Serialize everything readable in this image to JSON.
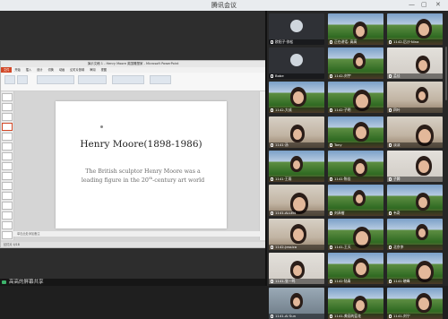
{
  "window": {
    "title": "腾讯会议"
  },
  "ppt": {
    "window_title": "演示文稿 1 - Henry Moore 英国雕塑家 - Microsoft PowerPoint",
    "tabs": [
      "文件",
      "开始",
      "插入",
      "设计",
      "切换",
      "动画",
      "幻灯片放映",
      "审阅",
      "视图"
    ],
    "active_tab": "开始",
    "notes_placeholder": "单击此处添加备注",
    "status": "幻灯片 4/18"
  },
  "slide": {
    "title": "Henry Moore(1898-1986)",
    "body_part1": "The British sculptor Henry Moore was a leading figure in the 20",
    "body_sup": "th",
    "body_part2": "-century art world"
  },
  "share": {
    "status_label": "高高的屏幕共享"
  },
  "participants": [
    {
      "name": "欧阳子·徐松",
      "bg": "dark"
    },
    {
      "name": "正在讲话: 高高",
      "bg": "tree"
    },
    {
      "name": "1142-后沙·Nina",
      "bg": "tree"
    },
    {
      "name": "Bobe",
      "bg": "dark"
    },
    {
      "name": "1142-刘宇",
      "bg": "tree"
    },
    {
      "name": "孟佳",
      "bg": "wall"
    },
    {
      "name": "1142-大成",
      "bg": "tree"
    },
    {
      "name": "1142·子明",
      "bg": "tree"
    },
    {
      "name": "四叶",
      "bg": "room"
    },
    {
      "name": "1141·汤",
      "bg": "room"
    },
    {
      "name": "Tony",
      "bg": "tree"
    },
    {
      "name": "淡淡",
      "bg": "room"
    },
    {
      "name": "1141·王雨",
      "bg": "tree"
    },
    {
      "name": "1141·陈佳",
      "bg": "tree"
    },
    {
      "name": "子腾",
      "bg": "wall"
    },
    {
      "name": "1141-ALLEN",
      "bg": "room"
    },
    {
      "name": "刘泽楷",
      "bg": "tree"
    },
    {
      "name": "韦奇",
      "bg": "tree"
    },
    {
      "name": "1142-Jessica",
      "bg": "room"
    },
    {
      "name": "1141-王天",
      "bg": "tree"
    },
    {
      "name": "北京李",
      "bg": "tree"
    },
    {
      "name": "1141-张一鸣",
      "bg": "wall"
    },
    {
      "name": "1142·陆青",
      "bg": "tree"
    },
    {
      "name": "1141·晓峰",
      "bg": "tree"
    },
    {
      "name": "1141-Al Sun",
      "bg": "blur"
    },
    {
      "name": "1141-美丽的蓝花",
      "bg": "tree"
    },
    {
      "name": "1141-刘宁",
      "bg": "tree"
    }
  ],
  "colors": {
    "ppt_accent": "#d24726",
    "speaking": "#3db36b"
  }
}
